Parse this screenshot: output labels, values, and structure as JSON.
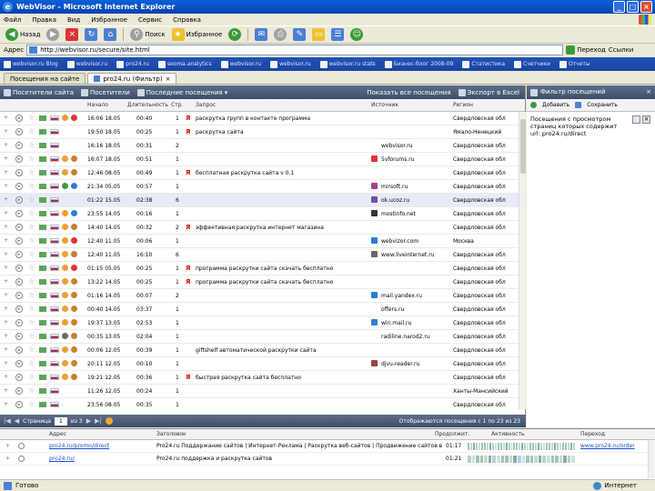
{
  "window": {
    "title": "WebVisor - Microsoft Internet Explorer",
    "controls": [
      "_",
      "□",
      "×"
    ]
  },
  "menu": [
    "Файл",
    "Правка",
    "Вид",
    "Избранное",
    "Сервис",
    "Справка"
  ],
  "toolbar": {
    "back_label": "Назад",
    "search_label": "Поиск",
    "favorites_label": "Избранное"
  },
  "address": {
    "label": "Адрес",
    "url": "http://webvisor.ru/secure/site.html",
    "go_label": "Переход",
    "links_label": "Ссылки"
  },
  "links": [
    "webvisor.ru Blog",
    "webvisor.ru",
    "pro24.ru",
    "seoma.analytics",
    "webvisor.ru",
    "webvisor.ru",
    "webvisor.ru stats",
    "Бизнес-блог 2008-09",
    "Статистика",
    "Счетчики",
    "Отчеты"
  ],
  "tabs": [
    {
      "label": "Посещения на сайте",
      "active": false
    },
    {
      "label": "pro24.ru (Фильтр)",
      "active": true
    }
  ],
  "main_toolbar": {
    "visits_btn": "Посетители сайта",
    "visitors_btn": "Посетители",
    "last_visits_btn": "Последние посещения",
    "show_all_btn": "Показать все посещения",
    "export_btn": "Экспорт в Excel"
  },
  "columns": {
    "start": "Начало",
    "duration": "Длительность",
    "pages": "Стр.",
    "query": "Запрос",
    "referrer": "Источник",
    "region": "Регион"
  },
  "rows": [
    {
      "time": "16:06 18.05",
      "dur": "00:40",
      "pages": "1",
      "yandex": true,
      "query": "раскрутка групп в контакте программа",
      "site": "",
      "site_color": "",
      "region": "Свердловская обл",
      "b1": "#e8a030",
      "b2": "#d33",
      "selected": false
    },
    {
      "time": "19:50 18.05",
      "dur": "00:25",
      "pages": "1",
      "yandex": true,
      "query": "раскрутка сайта",
      "site": "",
      "site_color": "",
      "region": "Ямало-Ненецкий",
      "b1": "",
      "b2": "",
      "selected": false
    },
    {
      "time": "16:16 18.05",
      "dur": "00:31",
      "pages": "2",
      "yandex": false,
      "query": "",
      "site": "webvisor.ru",
      "site_color": "",
      "region": "Свердловская обл",
      "b1": "",
      "b2": "",
      "selected": false
    },
    {
      "time": "16:07 18.05",
      "dur": "00:51",
      "pages": "1",
      "yandex": false,
      "query": "",
      "site": "5vforums.ru",
      "site_color": "#d33",
      "region": "Свердловская обл",
      "b1": "#e8a030",
      "b2": "#c88030",
      "selected": false
    },
    {
      "time": "12:46 08.05",
      "dur": "00:49",
      "pages": "1",
      "yandex": true,
      "query": "бесплатная раскрутка сайта v 0.1",
      "site": "",
      "site_color": "",
      "region": "Свердловская обл",
      "b1": "#e8a030",
      "b2": "#c88030",
      "selected": false
    },
    {
      "time": "21:34 05.05",
      "dur": "00:57",
      "pages": "1",
      "yandex": false,
      "query": "",
      "site": "mirsoft.ru",
      "site_color": "#a04090",
      "region": "Свердловская обл",
      "b1": "#3a9a3a",
      "b2": "#2a7fd4",
      "selected": false
    },
    {
      "time": "01:22 15.05",
      "dur": "02:38",
      "pages": "6",
      "yandex": false,
      "query": "",
      "site": "ok.ucoz.ru",
      "site_color": "#7050a0",
      "region": "Свердловская обл",
      "b1": "",
      "b2": "",
      "selected": true
    },
    {
      "time": "23:55 14.05",
      "dur": "00:16",
      "pages": "1",
      "yandex": false,
      "query": "",
      "site": "mostinfo.net",
      "site_color": "#333",
      "region": "Свердловская обл",
      "b1": "#e8a030",
      "b2": "#2a7fd4",
      "selected": false
    },
    {
      "time": "14:40 14.05",
      "dur": "00:32",
      "pages": "2",
      "yandex": true,
      "query": "эффективная раскрутка интернет магазина",
      "site": "",
      "site_color": "",
      "region": "Свердловская обл",
      "b1": "#e8a030",
      "b2": "#c88030",
      "selected": false
    },
    {
      "time": "12:40 11.05",
      "dur": "00:06",
      "pages": "1",
      "yandex": false,
      "query": "",
      "site": "webvizor.com",
      "site_color": "#2a7fd4",
      "region": "Москва",
      "b1": "#e8a030",
      "b2": "#d33",
      "selected": false
    },
    {
      "time": "12:40 11.05",
      "dur": "16:10",
      "pages": "6",
      "yandex": false,
      "query": "",
      "site": "www.liveinternet.ru",
      "site_color": "#666",
      "region": "Свердловская обл",
      "b1": "#e8a030",
      "b2": "#c88030",
      "selected": false
    },
    {
      "time": "01:15 05.05",
      "dur": "00:25",
      "pages": "1",
      "yandex": true,
      "query": "программа раскрутки сайта скачать бесплатно",
      "site": "",
      "site_color": "",
      "region": "Свердловская обл",
      "b1": "#e8a030",
      "b2": "#d33",
      "selected": false
    },
    {
      "time": "13:22 14.05",
      "dur": "00:25",
      "pages": "1",
      "yandex": true,
      "query": "программа раскрутки сайта скачать бесплатно",
      "site": "",
      "site_color": "",
      "region": "Свердловская обл",
      "b1": "#e8a030",
      "b2": "#c88030",
      "selected": false
    },
    {
      "time": "01:16 14.05",
      "dur": "00:07",
      "pages": "2",
      "yandex": false,
      "query": "",
      "site": "mail.yandex.ru",
      "site_color": "#2a7fd4",
      "region": "Свердловская обл",
      "b1": "#e8a030",
      "b2": "#c88030",
      "selected": false
    },
    {
      "time": "00:40 14.05",
      "dur": "03:37",
      "pages": "1",
      "yandex": false,
      "query": "",
      "site": "offers.ru",
      "site_color": "",
      "region": "Свердловская обл",
      "b1": "#e8a030",
      "b2": "#c88030",
      "selected": false
    },
    {
      "time": "19:37 13.05",
      "dur": "02:53",
      "pages": "1",
      "yandex": false,
      "query": "",
      "site": "win.mail.ru",
      "site_color": "#2a7fd4",
      "region": "Свердловская обл",
      "b1": "#e8a030",
      "b2": "#c88030",
      "selected": false
    },
    {
      "time": "00:35 13.05",
      "dur": "02:04",
      "pages": "1",
      "yandex": false,
      "query": "",
      "site": "radiline.narod2.ru",
      "site_color": "",
      "region": "Свердловская обл",
      "b1": "#666",
      "b2": "#c88030",
      "selected": false
    },
    {
      "time": "00:06 12.05",
      "dur": "00:39",
      "pages": "1",
      "yandex": false,
      "query": "giftshelf автоматической раскрутки сайта",
      "site": "",
      "site_color": "",
      "region": "Свердловская обл",
      "b1": "#e8a030",
      "b2": "#c88030",
      "selected": false
    },
    {
      "time": "20:11 12.05",
      "dur": "00:10",
      "pages": "1",
      "yandex": false,
      "query": "",
      "site": "djvu-reader.ru",
      "site_color": "#a04040",
      "region": "Свердловская обл",
      "b1": "#e8a030",
      "b2": "#c88030",
      "selected": false
    },
    {
      "time": "19:21 12.05",
      "dur": "00:36",
      "pages": "1",
      "yandex": true,
      "query": "быстрая раскрутка сайта бесплатно",
      "site": "",
      "site_color": "",
      "region": "Свердловская обл",
      "b1": "#e8a030",
      "b2": "#c88030",
      "selected": false
    },
    {
      "time": "11:26 12.05",
      "dur": "00:24",
      "pages": "1",
      "yandex": false,
      "query": "",
      "site": "",
      "site_color": "",
      "region": "Ханты-Мансийский",
      "b1": "",
      "b2": "",
      "selected": false
    },
    {
      "time": "23:56 08.05",
      "dur": "00:35",
      "pages": "1",
      "yandex": false,
      "query": "",
      "site": "",
      "site_color": "",
      "region": "Свердловская обл",
      "b1": "",
      "b2": "",
      "selected": false
    }
  ],
  "pager": {
    "page_label": "Страница",
    "page_value": "1",
    "of_label": "из 3",
    "summary": "Отображаются посещения с 1 по 23 из 23"
  },
  "side": {
    "title": "Фильтр посещений",
    "add_btn": "Добавить",
    "save_btn": "Сохранить",
    "filter_text": "Посещения с просмотром страниц которых содержит url: pro24.ru/direct"
  },
  "bottom": {
    "columns": {
      "address": "Адрес",
      "title": "Заголовок",
      "duration": "Продолжит.",
      "activity": "Активность",
      "referrer": "Переход"
    },
    "rows": [
      {
        "address": "pro24.ru/promo/direct",
        "title": "Pro24.ru Поддержание сайтов | Интернет-Реклама | Раскрутка веб-сайтов | Продвижение сайтов в интернете",
        "duration": "01:17",
        "referrer": "www.pro24.ru/order"
      },
      {
        "address": "pro24.ru/",
        "title": "Pro24.ru поддержка и раскрутка сайтов",
        "duration": "01:21",
        "referrer": ""
      }
    ]
  },
  "status": {
    "text": "Готово",
    "zone": "Интернет"
  }
}
